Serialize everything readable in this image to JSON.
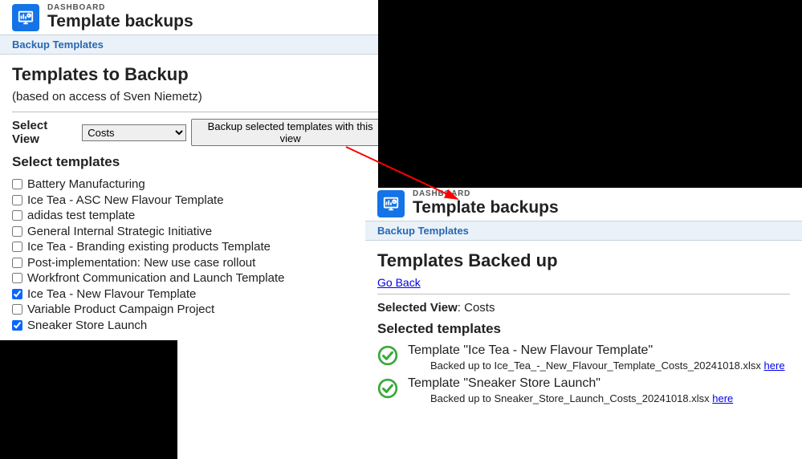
{
  "left": {
    "crumb": "DASHBOARD",
    "title": "Template backups",
    "section": "Backup Templates",
    "heading": "Templates to Backup",
    "based_on": "(based on access of Sven Niemetz)",
    "select_view_label": "Select View",
    "view_value": "Costs",
    "backup_button": "Backup selected templates with this view",
    "select_templates_label": "Select templates",
    "templates": [
      {
        "label": "Battery Manufacturing",
        "checked": false
      },
      {
        "label": "Ice Tea - ASC New Flavour Template",
        "checked": false
      },
      {
        "label": "adidas test template",
        "checked": false
      },
      {
        "label": "General Internal Strategic Initiative",
        "checked": false
      },
      {
        "label": "Ice Tea - Branding existing products Template",
        "checked": false
      },
      {
        "label": "Post-implementation: New use case rollout",
        "checked": false
      },
      {
        "label": "Workfront Communication and Launch Template",
        "checked": false
      },
      {
        "label": "Ice Tea - New Flavour Template",
        "checked": true
      },
      {
        "label": "Variable Product Campaign Project",
        "checked": false
      },
      {
        "label": "Sneaker Store Launch",
        "checked": true
      }
    ]
  },
  "right": {
    "crumb": "DASHBOARD",
    "title": "Template backups",
    "section": "Backup Templates",
    "heading": "Templates Backed up",
    "go_back": "Go Back",
    "selected_view_label": "Selected View",
    "selected_view_value": "Costs",
    "selected_templates_label": "Selected templates",
    "results": [
      {
        "title": "Template \"Ice Tea - New Flavour Template\"",
        "sub_prefix": "Backed up to ",
        "filename": "Ice_Tea_-_New_Flavour_Template_Costs_20241018.xlsx",
        "here": "here"
      },
      {
        "title": "Template \"Sneaker Store Launch\"",
        "sub_prefix": "Backed up to ",
        "filename": "Sneaker_Store_Launch_Costs_20241018.xlsx",
        "here": "here"
      }
    ]
  }
}
